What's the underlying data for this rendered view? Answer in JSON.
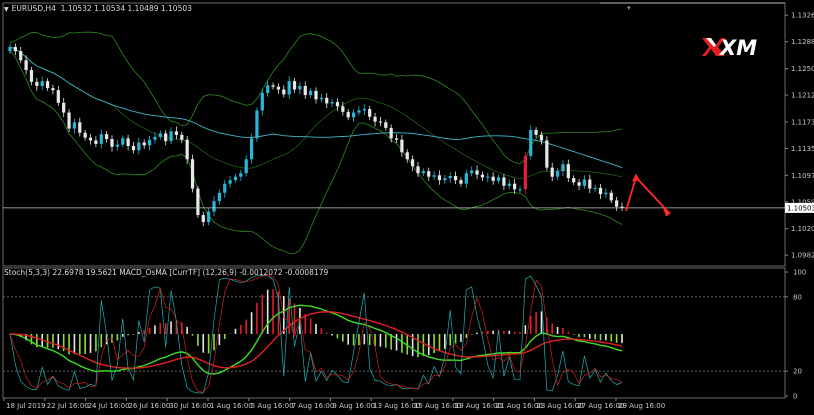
{
  "header": {
    "symbol": "EURUSD,H4",
    "ohlc": "1.10532 1.10534 1.10489 1.10503"
  },
  "sub_header": {
    "text": "Stoch(5,3,3) 22.6978 19.5621  MACD_OsMA [CurrTF] (12,26,9) -0.0012072 -0.0008179"
  },
  "logo": {
    "text": "XM",
    "color": "#ffffff",
    "accent": "#e31e24"
  },
  "current_price": "1.10503",
  "colors": {
    "bull": "#29b6d8",
    "bear": "#e8e8e8",
    "band": "#2f8a1f",
    "ma": "#3fb6c8",
    "hist_pos": "#e02020",
    "hist_neg": "#8cdc40",
    "osc_red": "#e02020",
    "osc_green": "#3ce020",
    "stoch_main": "#20b0b0",
    "stoch_sig": "#d02020",
    "arrow": "#ff2a2a",
    "grid": "#2a2a2a"
  },
  "chart_data": [
    {
      "type": "candlestick",
      "title": "EURUSD,H4",
      "y_ticks": [
        "1.13265",
        "1.12885",
        "1.12500",
        "1.12120",
        "1.11735",
        "1.11355",
        "1.10970",
        "1.10590",
        "1.10205",
        "1.09825"
      ],
      "ylim": [
        1.0967,
        1.1344
      ],
      "x_ticks": [
        "18 Jul 2019",
        "22 Jul 16:00",
        "24 Jul 16:00",
        "26 Jul 16:00",
        "30 Jul 16:00",
        "1 Aug 16:00",
        "5 Aug 16:00",
        "7 Aug 16:00",
        "9 Aug 16:00",
        "13 Aug 16:00",
        "15 Aug 16:00",
        "19 Aug 16:00",
        "21 Aug 16:00",
        "23 Aug 16:00",
        "27 Aug 16:00",
        "29 Aug 16:00"
      ],
      "series": [
        {
          "close": [
            1.1281,
            1.1275,
            1.1262,
            1.1248,
            1.1231,
            1.1225,
            1.1232,
            1.1222,
            1.1219,
            1.1201,
            1.1187,
            1.1164,
            1.1173,
            1.1158,
            1.1151,
            1.1147,
            1.1142,
            1.1156,
            1.1149,
            1.1138,
            1.1141,
            1.115,
            1.1139,
            1.1133,
            1.1144,
            1.114,
            1.1148,
            1.1152,
            1.1157,
            1.1146,
            1.116,
            1.1155,
            1.1148,
            1.112,
            1.1078,
            1.104,
            1.103,
            1.1045,
            1.106,
            1.1072,
            1.1085,
            1.109,
            1.1095,
            1.11,
            1.112,
            1.115,
            1.119,
            1.1215,
            1.1226,
            1.1224,
            1.122,
            1.1213,
            1.1232,
            1.122,
            1.1225,
            1.1212,
            1.1218,
            1.1206,
            1.1208,
            1.12,
            1.1202,
            1.1196,
            1.1188,
            1.118,
            1.1187,
            1.119,
            1.1192,
            1.1181,
            1.1174,
            1.1173,
            1.1165,
            1.115,
            1.1148,
            1.113,
            1.112,
            1.111,
            1.11,
            1.1103,
            1.1095,
            1.1097,
            1.109,
            1.1093,
            1.1096,
            1.109,
            1.1085,
            1.11,
            1.1104,
            1.1098,
            1.1094,
            1.1095,
            1.1089,
            1.1094,
            1.1082,
            1.1085,
            1.1077,
            1.1077,
            1.1125,
            1.1162,
            1.1155,
            1.1147,
            1.1108,
            1.1095,
            1.1103,
            1.1113,
            1.1093,
            1.1087,
            1.1082,
            1.1091,
            1.1078,
            1.1079,
            1.107,
            1.1072,
            1.1061,
            1.1052,
            1.10503
          ]
        }
      ]
    },
    {
      "type": "bar",
      "title": "MACD_OsMA [CurrTF] (12,26,9)",
      "y_ticks": [
        "100",
        "80",
        "20",
        "0"
      ],
      "ylim": [
        0,
        100
      ]
    }
  ]
}
